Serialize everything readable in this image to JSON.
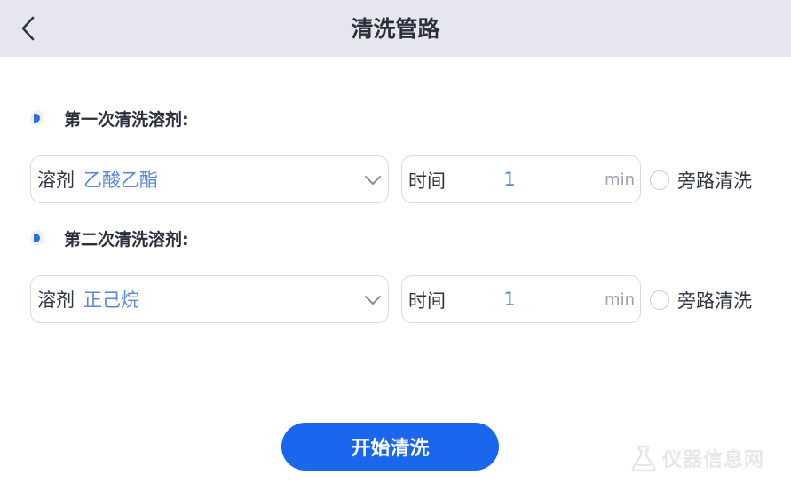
{
  "header": {
    "title": "清洗管路",
    "back_icon": "chevron-left-icon"
  },
  "sections": [
    {
      "label": "第一次清洗溶剂:",
      "solvent_label": "溶剂",
      "solvent_value": "乙酸乙酯",
      "time_label": "时间",
      "time_value": "1",
      "time_unit": "min",
      "bypass_label": "旁路清洗",
      "bypass_checked": false
    },
    {
      "label": "第二次清洗溶剂:",
      "solvent_label": "溶剂",
      "solvent_value": "正己烷",
      "time_label": "时间",
      "time_value": "1",
      "time_unit": "min",
      "bypass_label": "旁路清洗",
      "bypass_checked": false
    }
  ],
  "actions": {
    "start_label": "开始清洗"
  },
  "watermark": {
    "text": "仪器信息网"
  },
  "colors": {
    "accent": "#1a66ed",
    "value_text": "#5b86d9",
    "header_bg": "#e6e7ee"
  }
}
